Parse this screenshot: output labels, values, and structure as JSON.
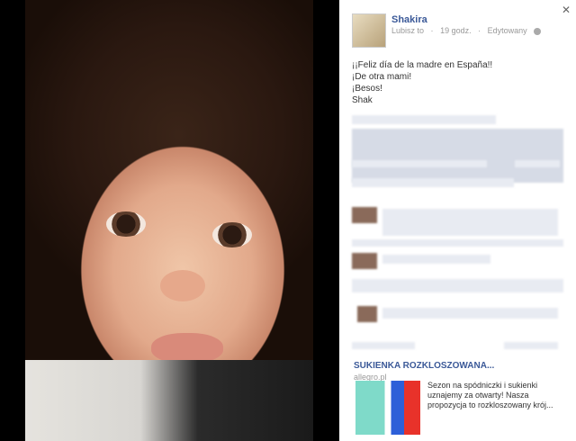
{
  "post": {
    "author": "Shakira",
    "like_label": "Lubisz to",
    "time": "19 godz.",
    "edited": "Edytowany",
    "lines": [
      "¡¡Feliz día de la madre en España!!",
      "¡De otra mami!",
      "¡Besos!",
      "Shak"
    ]
  },
  "ad": {
    "title": "SUKIENKA ROZKLOSZOWANA...",
    "url": "allegro.pl",
    "description": "Sezon na spódniczki i sukienki uznajemy za otwarty! Nasza propozycja to rozkloszowany krój..."
  },
  "icons": {
    "close": "close-icon",
    "privacy": "globe-icon"
  }
}
